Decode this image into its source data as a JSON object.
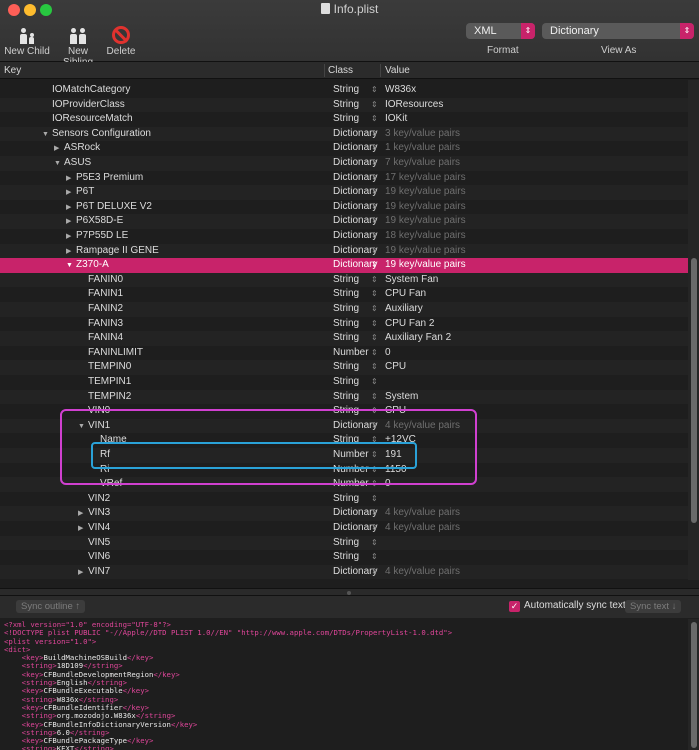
{
  "window": {
    "title": "Info.plist"
  },
  "toolbar": {
    "new_child": "New Child",
    "new_sibling": "New Sibling",
    "delete": "Delete",
    "format_value": "XML",
    "format_label": "Format",
    "view_value": "Dictionary",
    "view_label": "View As"
  },
  "columns": {
    "key": "Key",
    "class": "Class",
    "value": "Value"
  },
  "rows": [
    {
      "indent": 3,
      "tri": "",
      "key": "IOMatchCategory",
      "class": "String",
      "value": "W836x",
      "dim": false
    },
    {
      "indent": 3,
      "tri": "",
      "key": "IOProviderClass",
      "class": "String",
      "value": "IOResources",
      "dim": false
    },
    {
      "indent": 3,
      "tri": "",
      "key": "IOResourceMatch",
      "class": "String",
      "value": "IOKit",
      "dim": false
    },
    {
      "indent": 3,
      "tri": "▼",
      "key": "Sensors Configuration",
      "class": "Dictionary",
      "value": "3 key/value pairs",
      "dim": true
    },
    {
      "indent": 4,
      "tri": "▶",
      "key": "ASRock",
      "class": "Dictionary",
      "value": "1 key/value pairs",
      "dim": true
    },
    {
      "indent": 4,
      "tri": "▼",
      "key": "ASUS",
      "class": "Dictionary",
      "value": "7 key/value pairs",
      "dim": true
    },
    {
      "indent": 5,
      "tri": "▶",
      "key": "P5E3 Premium",
      "class": "Dictionary",
      "value": "17 key/value pairs",
      "dim": true
    },
    {
      "indent": 5,
      "tri": "▶",
      "key": "P6T",
      "class": "Dictionary",
      "value": "19 key/value pairs",
      "dim": true
    },
    {
      "indent": 5,
      "tri": "▶",
      "key": "P6T DELUXE V2",
      "class": "Dictionary",
      "value": "19 key/value pairs",
      "dim": true
    },
    {
      "indent": 5,
      "tri": "▶",
      "key": "P6X58D-E",
      "class": "Dictionary",
      "value": "19 key/value pairs",
      "dim": true
    },
    {
      "indent": 5,
      "tri": "▶",
      "key": "P7P55D LE",
      "class": "Dictionary",
      "value": "18 key/value pairs",
      "dim": true
    },
    {
      "indent": 5,
      "tri": "▶",
      "key": "Rampage II GENE",
      "class": "Dictionary",
      "value": "19 key/value pairs",
      "dim": true
    },
    {
      "indent": 5,
      "tri": "▼",
      "key": "Z370-A",
      "class": "Dictionary",
      "value": "19 key/value pairs",
      "dim": true,
      "selected": true
    },
    {
      "indent": 6,
      "tri": "",
      "key": "FANIN0",
      "class": "String",
      "value": "System Fan",
      "dim": false
    },
    {
      "indent": 6,
      "tri": "",
      "key": "FANIN1",
      "class": "String",
      "value": "CPU Fan",
      "dim": false
    },
    {
      "indent": 6,
      "tri": "",
      "key": "FANIN2",
      "class": "String",
      "value": "Auxiliary",
      "dim": false
    },
    {
      "indent": 6,
      "tri": "",
      "key": "FANIN3",
      "class": "String",
      "value": "CPU Fan 2",
      "dim": false
    },
    {
      "indent": 6,
      "tri": "",
      "key": "FANIN4",
      "class": "String",
      "value": "Auxiliary Fan 2",
      "dim": false
    },
    {
      "indent": 6,
      "tri": "",
      "key": "FANINLIMIT",
      "class": "Number",
      "value": "0",
      "dim": false
    },
    {
      "indent": 6,
      "tri": "",
      "key": "TEMPIN0",
      "class": "String",
      "value": "CPU",
      "dim": false
    },
    {
      "indent": 6,
      "tri": "",
      "key": "TEMPIN1",
      "class": "String",
      "value": "",
      "dim": false
    },
    {
      "indent": 6,
      "tri": "",
      "key": "TEMPIN2",
      "class": "String",
      "value": "System",
      "dim": false
    },
    {
      "indent": 6,
      "tri": "",
      "key": "VIN0",
      "class": "String",
      "value": "CPU",
      "dim": false
    },
    {
      "indent": 6,
      "tri": "▼",
      "key": "VIN1",
      "class": "Dictionary",
      "value": "4 key/value pairs",
      "dim": true
    },
    {
      "indent": 7,
      "tri": "",
      "key": "Name",
      "class": "String",
      "value": "+12VC",
      "dim": false
    },
    {
      "indent": 7,
      "tri": "",
      "key": "Rf",
      "class": "Number",
      "value": "191",
      "dim": false
    },
    {
      "indent": 7,
      "tri": "",
      "key": "Ri",
      "class": "Number",
      "value": "1150",
      "dim": false
    },
    {
      "indent": 7,
      "tri": "",
      "key": "VRef",
      "class": "Number",
      "value": "0",
      "dim": false
    },
    {
      "indent": 6,
      "tri": "",
      "key": "VIN2",
      "class": "String",
      "value": "",
      "dim": false
    },
    {
      "indent": 6,
      "tri": "▶",
      "key": "VIN3",
      "class": "Dictionary",
      "value": "4 key/value pairs",
      "dim": true
    },
    {
      "indent": 6,
      "tri": "▶",
      "key": "VIN4",
      "class": "Dictionary",
      "value": "4 key/value pairs",
      "dim": true
    },
    {
      "indent": 6,
      "tri": "",
      "key": "VIN5",
      "class": "String",
      "value": "",
      "dim": false
    },
    {
      "indent": 6,
      "tri": "",
      "key": "VIN6",
      "class": "String",
      "value": "",
      "dim": false
    },
    {
      "indent": 6,
      "tri": "▶",
      "key": "VIN7",
      "class": "Dictionary",
      "value": "4 key/value pairs",
      "dim": true
    }
  ],
  "sync": {
    "outline_button": "Sync outline ↑",
    "auto_label": "Automatically sync text",
    "auto_checked": true,
    "text_button": "Sync text ↓"
  },
  "xml_lines": [
    [
      [
        "tag",
        "<?xml version=\"1.0\" encoding=\"UTF-8\"?>"
      ]
    ],
    [
      [
        "tag",
        "<!DOCTYPE plist PUBLIC \"-//Apple//DTD PLIST 1.0//EN\" \"http://www.apple.com/DTDs/PropertyList-1.0.dtd\">"
      ]
    ],
    [
      [
        "tag",
        "<plist version=\"1.0\">"
      ]
    ],
    [
      [
        "tag",
        "<dict>"
      ]
    ],
    [
      [
        "txt",
        "    "
      ],
      [
        "tag",
        "<key>"
      ],
      [
        "txt",
        "BuildMachineOSBuild"
      ],
      [
        "tag",
        "</key>"
      ]
    ],
    [
      [
        "txt",
        "    "
      ],
      [
        "tag",
        "<string>"
      ],
      [
        "txt",
        "18D109"
      ],
      [
        "tag",
        "</string>"
      ]
    ],
    [
      [
        "txt",
        "    "
      ],
      [
        "tag",
        "<key>"
      ],
      [
        "txt",
        "CFBundleDevelopmentRegion"
      ],
      [
        "tag",
        "</key>"
      ]
    ],
    [
      [
        "txt",
        "    "
      ],
      [
        "tag",
        "<string>"
      ],
      [
        "txt",
        "English"
      ],
      [
        "tag",
        "</string>"
      ]
    ],
    [
      [
        "txt",
        "    "
      ],
      [
        "tag",
        "<key>"
      ],
      [
        "txt",
        "CFBundleExecutable"
      ],
      [
        "tag",
        "</key>"
      ]
    ],
    [
      [
        "txt",
        "    "
      ],
      [
        "tag",
        "<string>"
      ],
      [
        "txt",
        "W836x"
      ],
      [
        "tag",
        "</string>"
      ]
    ],
    [
      [
        "txt",
        "    "
      ],
      [
        "tag",
        "<key>"
      ],
      [
        "txt",
        "CFBundleIdentifier"
      ],
      [
        "tag",
        "</key>"
      ]
    ],
    [
      [
        "txt",
        "    "
      ],
      [
        "tag",
        "<string>"
      ],
      [
        "txt",
        "org.mozodojo.W836x"
      ],
      [
        "tag",
        "</string>"
      ]
    ],
    [
      [
        "txt",
        "    "
      ],
      [
        "tag",
        "<key>"
      ],
      [
        "txt",
        "CFBundleInfoDictionaryVersion"
      ],
      [
        "tag",
        "</key>"
      ]
    ],
    [
      [
        "txt",
        "    "
      ],
      [
        "tag",
        "<string>"
      ],
      [
        "txt",
        "6.0"
      ],
      [
        "tag",
        "</string>"
      ]
    ],
    [
      [
        "txt",
        "    "
      ],
      [
        "tag",
        "<key>"
      ],
      [
        "txt",
        "CFBundlePackageType"
      ],
      [
        "tag",
        "</key>"
      ]
    ],
    [
      [
        "txt",
        "    "
      ],
      [
        "tag",
        "<string>"
      ],
      [
        "txt",
        "KEXT"
      ],
      [
        "tag",
        "</string>"
      ]
    ]
  ]
}
